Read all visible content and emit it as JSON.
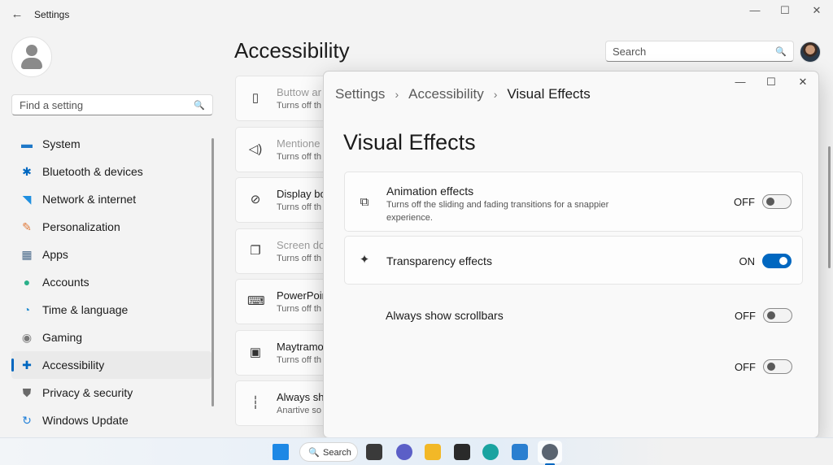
{
  "window": {
    "title": "Settings",
    "back_glyph": "←",
    "min_glyph": "—",
    "max_glyph": "☐",
    "close_glyph": "✕"
  },
  "sidebar": {
    "find_placeholder": "Find a setting",
    "items": [
      {
        "label": "System",
        "icon": "monitor-icon",
        "color": "#1e78c8"
      },
      {
        "label": "Bluetooth & devices",
        "icon": "bluetooth-icon",
        "color": "#0067c0"
      },
      {
        "label": "Network & internet",
        "icon": "wifi-icon",
        "color": "#1f8fe0"
      },
      {
        "label": "Personalization",
        "icon": "brush-icon",
        "color": "#e07a3a"
      },
      {
        "label": "Apps",
        "icon": "apps-icon",
        "color": "#4a6a8a"
      },
      {
        "label": "Accounts",
        "icon": "person-icon",
        "color": "#2bb08a"
      },
      {
        "label": "Time & language",
        "icon": "globe-clock-icon",
        "color": "#2a8fd0"
      },
      {
        "label": "Gaming",
        "icon": "controller-icon",
        "color": "#7a7a7a"
      },
      {
        "label": "Accessibility",
        "icon": "accessibility-icon",
        "color": "#0067c0"
      },
      {
        "label": "Privacy & security",
        "icon": "shield-icon",
        "color": "#6a6a6a"
      },
      {
        "label": "Windows Update",
        "icon": "update-icon",
        "color": "#1f7fd8"
      }
    ],
    "selected_index": 8
  },
  "header": {
    "page_title": "Accessibility",
    "search_placeholder": "Search"
  },
  "bg_cards": [
    {
      "title": "Buttow ar",
      "subtitle": "Turns off th",
      "icon": "phone-icon",
      "faded": true
    },
    {
      "title": "Mentione",
      "subtitle": "Turns off th",
      "icon": "speaker-icon",
      "faded": true
    },
    {
      "title": "Display bo",
      "subtitle": "Turns off th",
      "icon": "eye-off-icon",
      "faded": false
    },
    {
      "title": "Screen do",
      "subtitle": "Turns off th",
      "icon": "copy-icon",
      "faded": true
    },
    {
      "title": "PowerPoir",
      "subtitle": "Turns off th",
      "icon": "keyboard-icon",
      "faded": false
    },
    {
      "title": "Maytramo",
      "subtitle": "Turns off th",
      "icon": "display-settings-icon",
      "faded": false
    },
    {
      "title": "Always sh",
      "subtitle": "Anartive so",
      "icon": "scrollbar-icon",
      "faded": false
    }
  ],
  "dialog": {
    "breadcrumb": [
      "Settings",
      "Accessibility",
      "Visual Effects"
    ],
    "separator": "›",
    "title": "Visual Effects",
    "rows": [
      {
        "title": "Animation effects",
        "subtitle": "Turns off the sliding and fading transitions for a snappier experience.",
        "state": "OFF",
        "on": false,
        "icon": "animation-icon"
      },
      {
        "title": "Transparency effects",
        "subtitle": "",
        "state": "ON",
        "on": true,
        "icon": "sparkle-icon"
      },
      {
        "title": "Always show scrollbars",
        "subtitle": "",
        "state": "OFF",
        "on": false,
        "icon": ""
      },
      {
        "title": "",
        "subtitle": "",
        "state": "OFF",
        "on": false,
        "icon": ""
      }
    ]
  },
  "taskbar": {
    "search_label": "Search",
    "apps": [
      {
        "name": "start-button",
        "color": "#1e88e5"
      },
      {
        "name": "task-view",
        "color": "#3a3a3a"
      },
      {
        "name": "chat",
        "color": "#5b5fc7"
      },
      {
        "name": "file-explorer",
        "color": "#f2b827"
      },
      {
        "name": "store",
        "color": "#2a2a2a"
      },
      {
        "name": "edge",
        "color": "#1aa3a0"
      },
      {
        "name": "photos",
        "color": "#2a7fd0"
      },
      {
        "name": "settings",
        "color": "#5a6470"
      }
    ]
  }
}
